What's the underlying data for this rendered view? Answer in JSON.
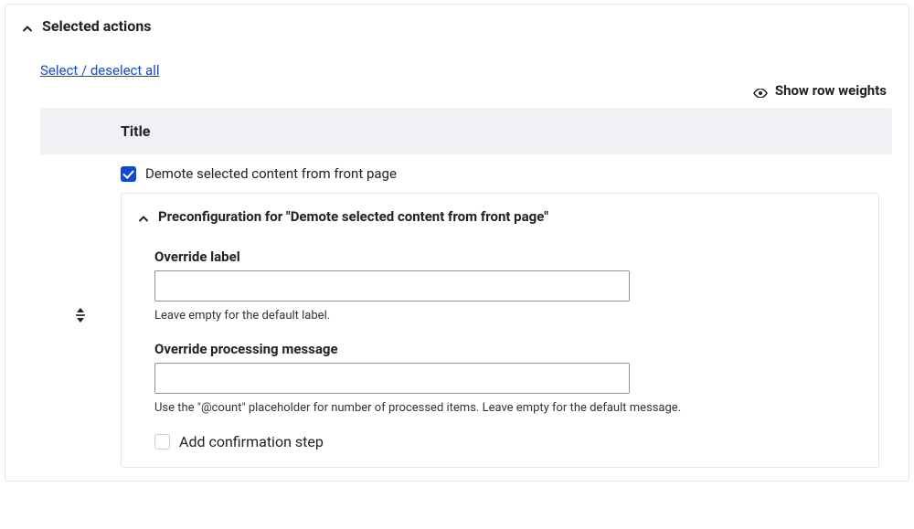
{
  "panel": {
    "title": "Selected actions"
  },
  "links": {
    "select_all": "Select / deselect all",
    "show_row_weights": "Show row weights"
  },
  "table": {
    "column_title": "Title"
  },
  "row": {
    "action_label": "Demote selected content from front page",
    "checked": true
  },
  "preconfig": {
    "title": "Preconfiguration for \"Demote selected content from front page\"",
    "override_label": {
      "label": "Override label",
      "value": "",
      "help": "Leave empty for the default label."
    },
    "override_message": {
      "label": "Override processing message",
      "value": "",
      "help": "Use the \"@count\" placeholder for number of processed items. Leave empty for the default message."
    },
    "confirm_step": {
      "label": "Add confirmation step",
      "checked": false
    }
  }
}
